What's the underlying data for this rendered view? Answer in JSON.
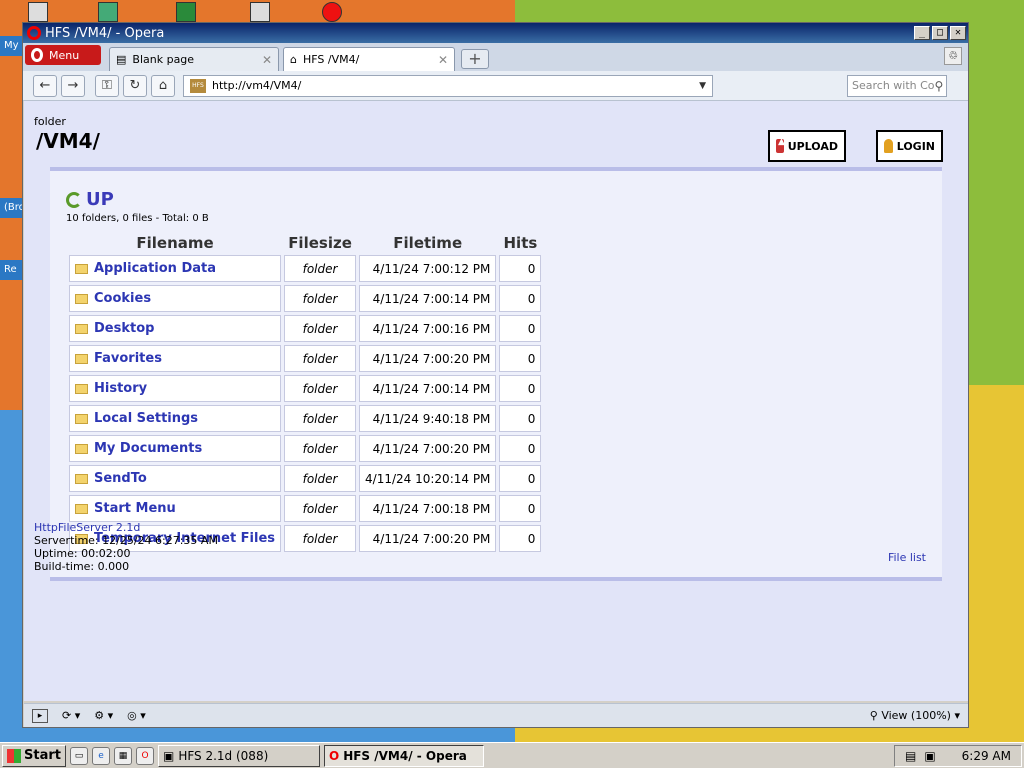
{
  "window": {
    "title": "HFS /VM4/ - Opera"
  },
  "desktop": {
    "side_labels": [
      "My",
      "(Bro",
      "Re"
    ]
  },
  "browser": {
    "menu_label": "Menu",
    "tabs": [
      {
        "label": "Blank page"
      },
      {
        "label": "HFS /VM4/"
      }
    ],
    "address": "http://vm4/VM4/",
    "search_placeholder": "Search with Co",
    "zoom_label": "View (100%)"
  },
  "page": {
    "folder_label": "folder",
    "folder_title": "/VM4/",
    "upload_label": "UPLOAD",
    "login_label": "LOGIN",
    "up_label": "UP",
    "summary": "10 folders, 0 files - Total: 0 B",
    "columns": [
      "Filename",
      "Filesize",
      "Filetime",
      "Hits"
    ],
    "files": [
      {
        "name": "Application Data",
        "size": "folder",
        "time": "4/11/24 7:00:12 PM",
        "hits": "0"
      },
      {
        "name": "Cookies",
        "size": "folder",
        "time": "4/11/24 7:00:14 PM",
        "hits": "0"
      },
      {
        "name": "Desktop",
        "size": "folder",
        "time": "4/11/24 7:00:16 PM",
        "hits": "0"
      },
      {
        "name": "Favorites",
        "size": "folder",
        "time": "4/11/24 7:00:20 PM",
        "hits": "0"
      },
      {
        "name": "History",
        "size": "folder",
        "time": "4/11/24 7:00:14 PM",
        "hits": "0"
      },
      {
        "name": "Local Settings",
        "size": "folder",
        "time": "4/11/24 9:40:18 PM",
        "hits": "0"
      },
      {
        "name": "My Documents",
        "size": "folder",
        "time": "4/11/24 7:00:20 PM",
        "hits": "0"
      },
      {
        "name": "SendTo",
        "size": "folder",
        "time": "4/11/24 10:20:14 PM",
        "hits": "0"
      },
      {
        "name": "Start Menu",
        "size": "folder",
        "time": "4/11/24 7:00:18 PM",
        "hits": "0"
      },
      {
        "name": "Temporary Internet Files",
        "size": "folder",
        "time": "4/11/24 7:00:20 PM",
        "hits": "0"
      }
    ],
    "file_list_link": "File list",
    "footer": {
      "server_link": "HttpFileServer 2.1d",
      "servertime": "Servertime: 12/25/24 6:27:35 AM",
      "uptime": "Uptime: 00:02:00",
      "buildtime": "Build-time: 0.000"
    }
  },
  "taskbar": {
    "start_label": "Start",
    "tasks": [
      {
        "label": "HFS 2.1d (088)"
      },
      {
        "label": "HFS /VM4/ - Opera"
      }
    ],
    "clock": "6:29 AM"
  }
}
